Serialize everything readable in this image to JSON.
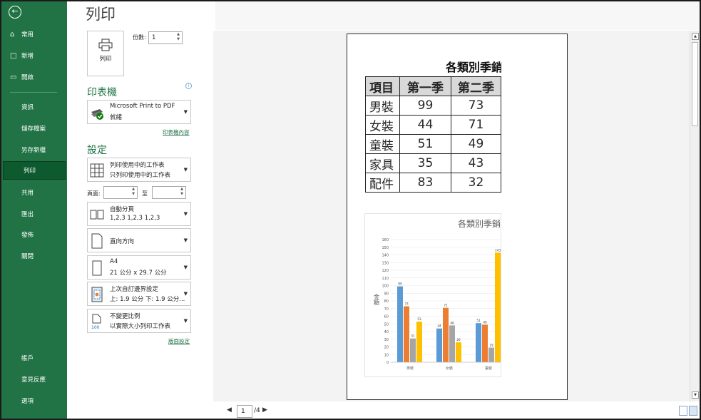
{
  "sidebar": {
    "back_icon": "arrow-left-icon",
    "items": [
      {
        "label": "常用",
        "icon": "home-icon"
      },
      {
        "label": "新增",
        "icon": "new-file-icon"
      },
      {
        "label": "開啟",
        "icon": "folder-open-icon"
      },
      {
        "label": "資訊"
      },
      {
        "label": "儲存檔案"
      },
      {
        "label": "另存新檔"
      },
      {
        "label": "列印"
      },
      {
        "label": "共用"
      },
      {
        "label": "匯出"
      },
      {
        "label": "發佈"
      },
      {
        "label": "關閉"
      },
      {
        "label": "帳戶"
      },
      {
        "label": "意見反應"
      },
      {
        "label": "選項"
      }
    ],
    "active": "列印",
    "bg_color": "#217346"
  },
  "print": {
    "title": "列印",
    "print_button_label": "列印",
    "copies_label": "份數:",
    "copies_value": "1"
  },
  "printer": {
    "heading": "印表機",
    "name": "Microsoft Print to PDF",
    "status": "就緒",
    "properties_link": "印表機內容"
  },
  "settings": {
    "heading": "設定",
    "scope": {
      "line1": "列印使用中的工作表",
      "line2": "只列印使用中的工作表"
    },
    "pages_label": "頁面:",
    "to_label": "至",
    "collate": {
      "line1": "自動分頁",
      "line2": "1,2,3    1,2,3    1,2,3"
    },
    "orientation": {
      "line1": "直向方向"
    },
    "paper": {
      "line1": "A4",
      "line2": "21 公分 x 29.7 公分"
    },
    "margins": {
      "line1": "上次自訂邊界設定",
      "line2": "上: 1.9 公分 下: 1.9 公分..."
    },
    "scaling": {
      "line1": "不變更比例",
      "line2": "以實際大小列印工作表"
    },
    "page_setup_link": "版面設定"
  },
  "preview": {
    "sheet_title": "各類別季銷",
    "table": {
      "headers": [
        "項目",
        "第一季",
        "第二季"
      ],
      "rows": [
        [
          "男裝",
          "99",
          "73"
        ],
        [
          "女裝",
          "44",
          "71"
        ],
        [
          "童裝",
          "51",
          "49"
        ],
        [
          "家具",
          "35",
          "43"
        ],
        [
          "配件",
          "83",
          "32"
        ]
      ]
    },
    "current_page": "1",
    "total_pages": "/4"
  },
  "chart_data": {
    "type": "bar",
    "title": "各類別季銷",
    "ylabel": "金額",
    "ylim": [
      0,
      160
    ],
    "yticks": [
      0,
      10,
      20,
      30,
      40,
      50,
      60,
      70,
      80,
      90,
      100,
      110,
      120,
      130,
      140,
      150,
      160
    ],
    "categories": [
      "男裝",
      "女裝",
      "童裝"
    ],
    "series": [
      {
        "color": "#5b9bd5",
        "values": [
          99,
          44,
          51
        ]
      },
      {
        "color": "#ed7d31",
        "values": [
          73,
          71,
          49
        ]
      },
      {
        "color": "#a5a5a5",
        "values": [
          31,
          48,
          19
        ]
      },
      {
        "color": "#ffc000",
        "values": [
          53,
          26,
          143
        ]
      }
    ],
    "data_labels": true,
    "grid": true
  }
}
